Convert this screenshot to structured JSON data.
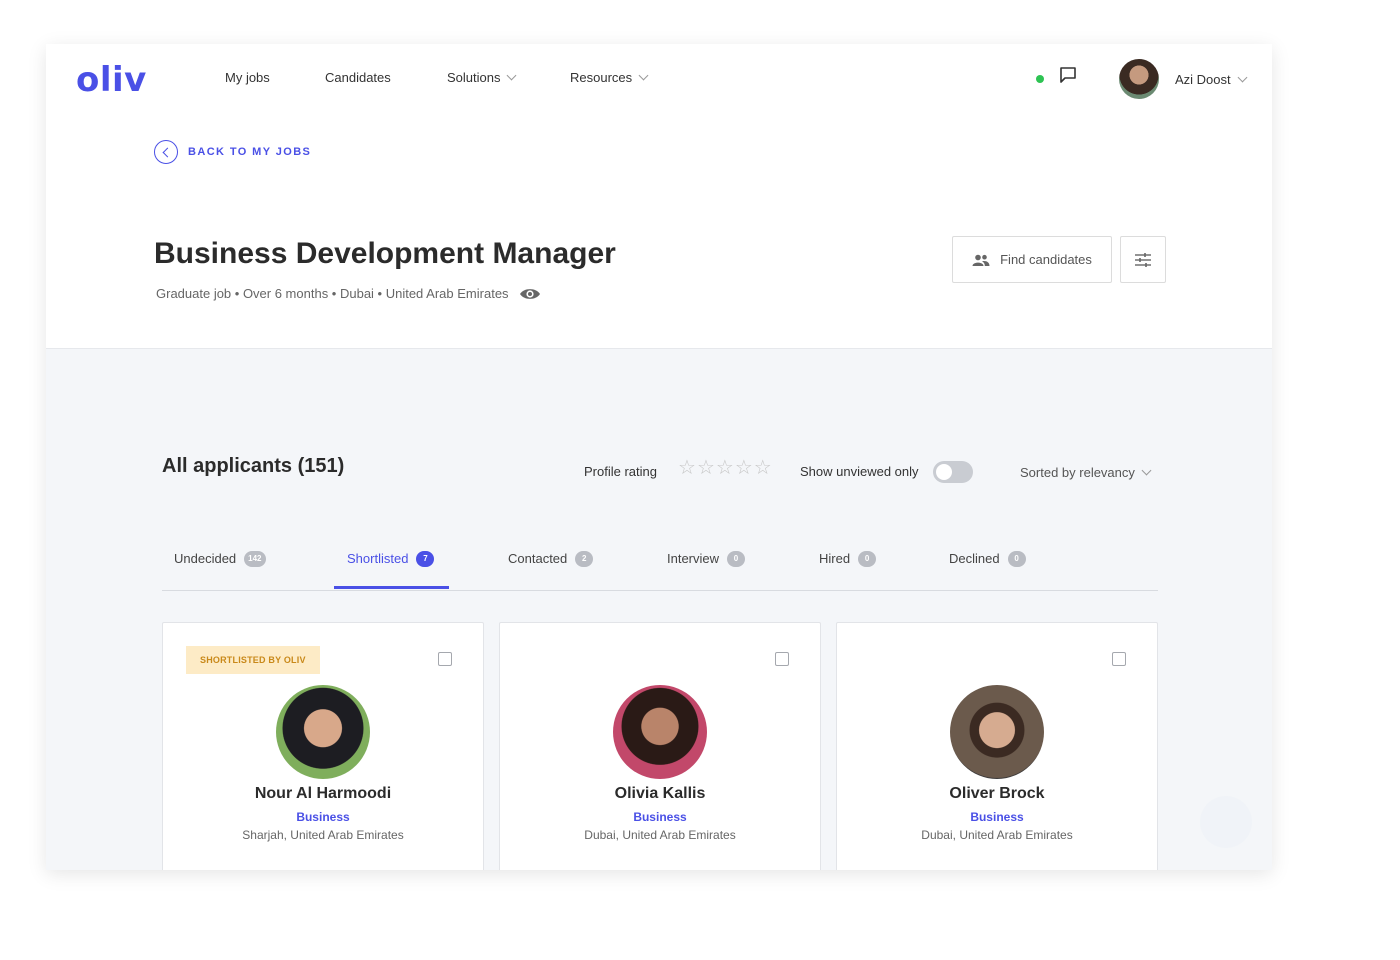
{
  "brand": {
    "logo": "oliv",
    "accent": "#4a50e6"
  },
  "nav": {
    "items": [
      {
        "label": "My jobs",
        "dropdown": false
      },
      {
        "label": "Candidates",
        "dropdown": false
      },
      {
        "label": "Solutions",
        "dropdown": true
      },
      {
        "label": "Resources",
        "dropdown": true
      }
    ]
  },
  "user": {
    "name": "Azi Doost",
    "status": "online",
    "status_color": "#2ec353"
  },
  "back_link": {
    "label": "BACK TO MY JOBS"
  },
  "job": {
    "title": "Business Development Manager",
    "meta": "Graduate job • Over 6 months • Dubai • United Arab Emirates"
  },
  "actions": {
    "find_candidates": "Find candidates",
    "filter_icon": "sliders-icon"
  },
  "applicants": {
    "title": "All applicants (151)",
    "profile_rating_label": "Profile rating",
    "rating_value": 0,
    "rating_max": 5,
    "show_unviewed_label": "Show unviewed only",
    "show_unviewed_on": false,
    "sort_label": "Sorted by relevancy"
  },
  "tabs": [
    {
      "label": "Undecided",
      "count": "142",
      "active": false
    },
    {
      "label": "Shortlisted",
      "count": "7",
      "active": true
    },
    {
      "label": "Contacted",
      "count": "2",
      "active": false
    },
    {
      "label": "Interview",
      "count": "0",
      "active": false
    },
    {
      "label": "Hired",
      "count": "0",
      "active": false
    },
    {
      "label": "Declined",
      "count": "0",
      "active": false
    }
  ],
  "candidates": [
    {
      "name": "Nour Al Harmoodi",
      "field": "Business",
      "location": "Sharjah, United Arab Emirates",
      "tag": "SHORTLISTED BY OLIV"
    },
    {
      "name": "Olivia Kallis",
      "field": "Business",
      "location": "Dubai, United Arab Emirates",
      "tag": ""
    },
    {
      "name": "Oliver Brock",
      "field": "Business",
      "location": "Dubai, United Arab Emirates",
      "tag": ""
    }
  ]
}
